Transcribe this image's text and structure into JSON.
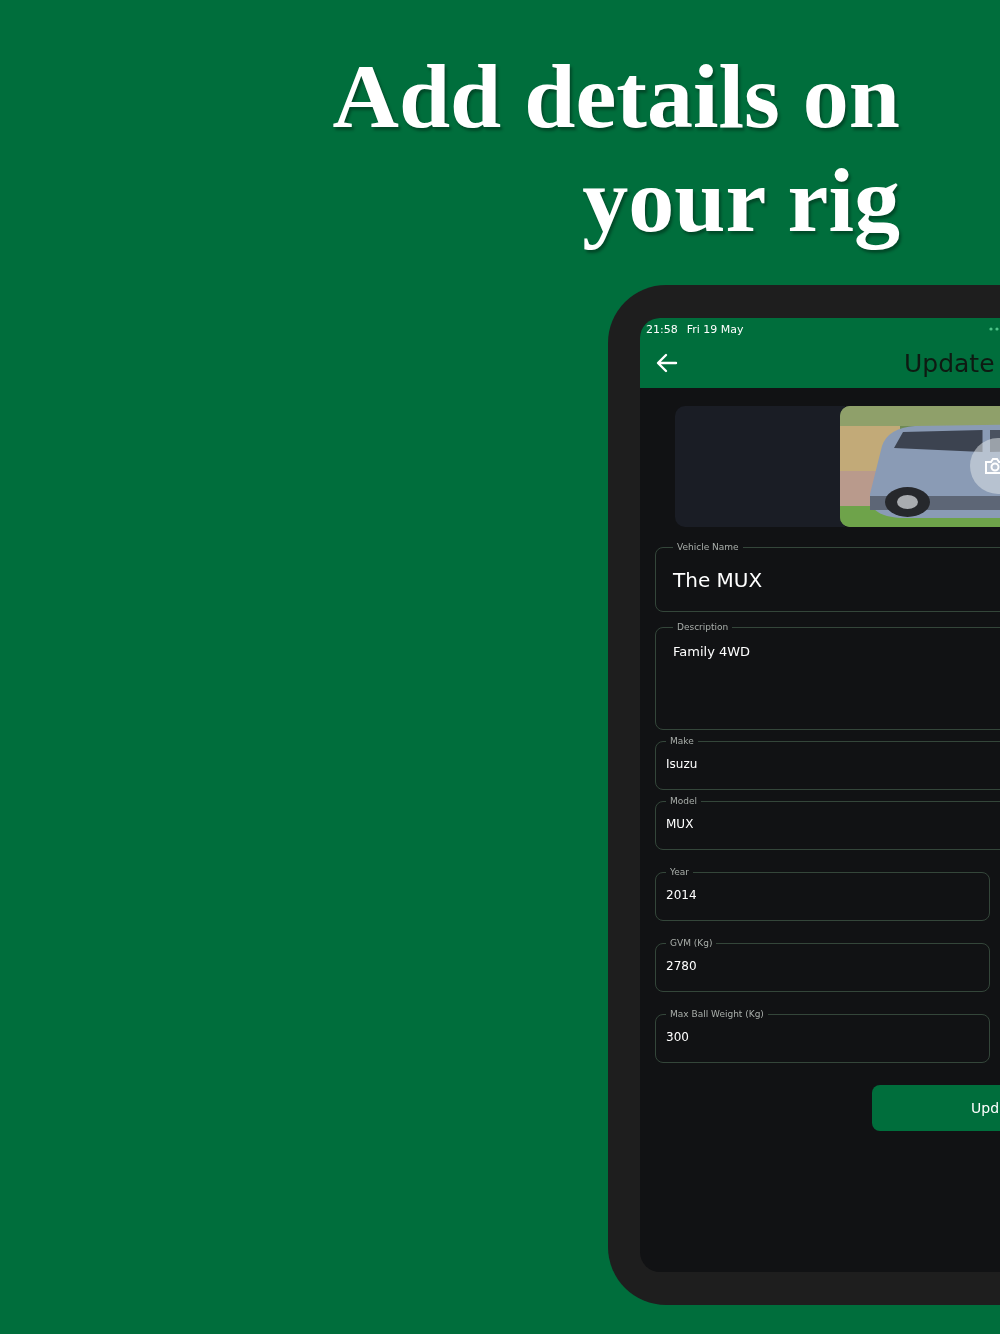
{
  "headline": [
    "Add details on",
    "your rig"
  ],
  "status_bar": {
    "time": "21:58",
    "date": "Fri 19 May"
  },
  "app_bar": {
    "title": "Update"
  },
  "fields": [
    {
      "kind": "title",
      "label": "Vehicle Name",
      "value": "The MUX"
    },
    {
      "kind": "multiline",
      "label": "Description",
      "value": "Family 4WD"
    },
    {
      "kind": "line",
      "label": "Make",
      "value": "Isuzu"
    },
    {
      "kind": "line",
      "label": "Model",
      "value": "MUX"
    },
    {
      "kind": "boxed",
      "label": "Year",
      "value": "2014"
    },
    {
      "kind": "boxed",
      "label": "GVM (Kg)",
      "value": "2780"
    },
    {
      "kind": "boxed",
      "label": "Max Ball Weight (Kg)",
      "value": "300"
    }
  ],
  "submit_button": "Upd"
}
